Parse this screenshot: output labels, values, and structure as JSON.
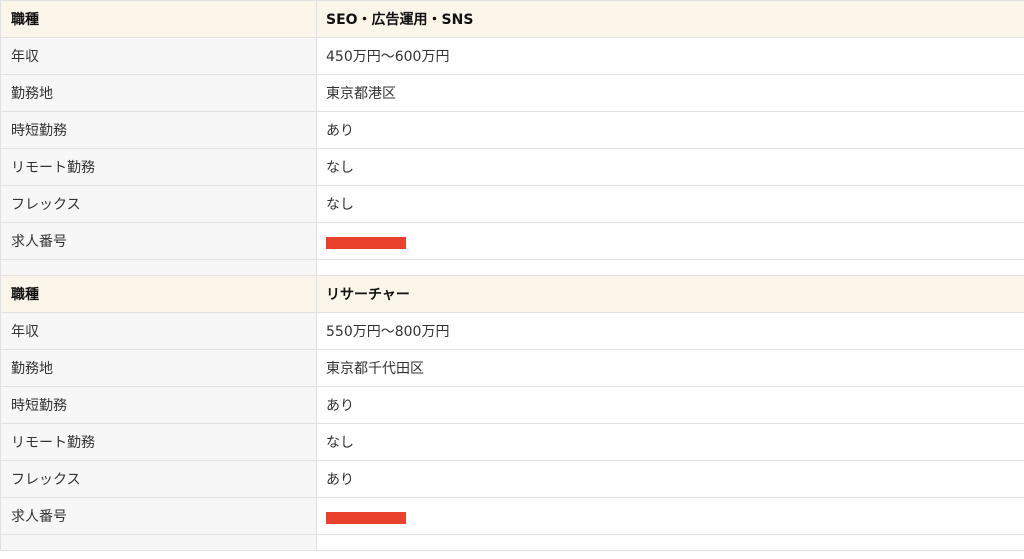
{
  "tables": [
    {
      "title_label": "職種",
      "title_value": "SEO・広告運用・SNS",
      "rows": [
        {
          "label": "年収",
          "value": "450万円〜600万円"
        },
        {
          "label": "勤務地",
          "value": "東京都港区"
        },
        {
          "label": "時短勤務",
          "value": "あり"
        },
        {
          "label": "リモート勤務",
          "value": "なし"
        },
        {
          "label": "フレックス",
          "value": "なし"
        },
        {
          "label": "求人番号",
          "value": ""
        }
      ]
    },
    {
      "title_label": "職種",
      "title_value": "リサーチャー",
      "rows": [
        {
          "label": "年収",
          "value": "550万円〜800万円"
        },
        {
          "label": "勤務地",
          "value": "東京都千代田区"
        },
        {
          "label": "時短勤務",
          "value": "あり"
        },
        {
          "label": "リモート勤務",
          "value": "なし"
        },
        {
          "label": "フレックス",
          "value": "あり"
        },
        {
          "label": "求人番号",
          "value": ""
        }
      ]
    }
  ],
  "colors": {
    "header_bg": "#fcf5ea",
    "label_bg": "#f7f7f7",
    "border": "#e1e1e1",
    "redaction": "#e8412c"
  }
}
